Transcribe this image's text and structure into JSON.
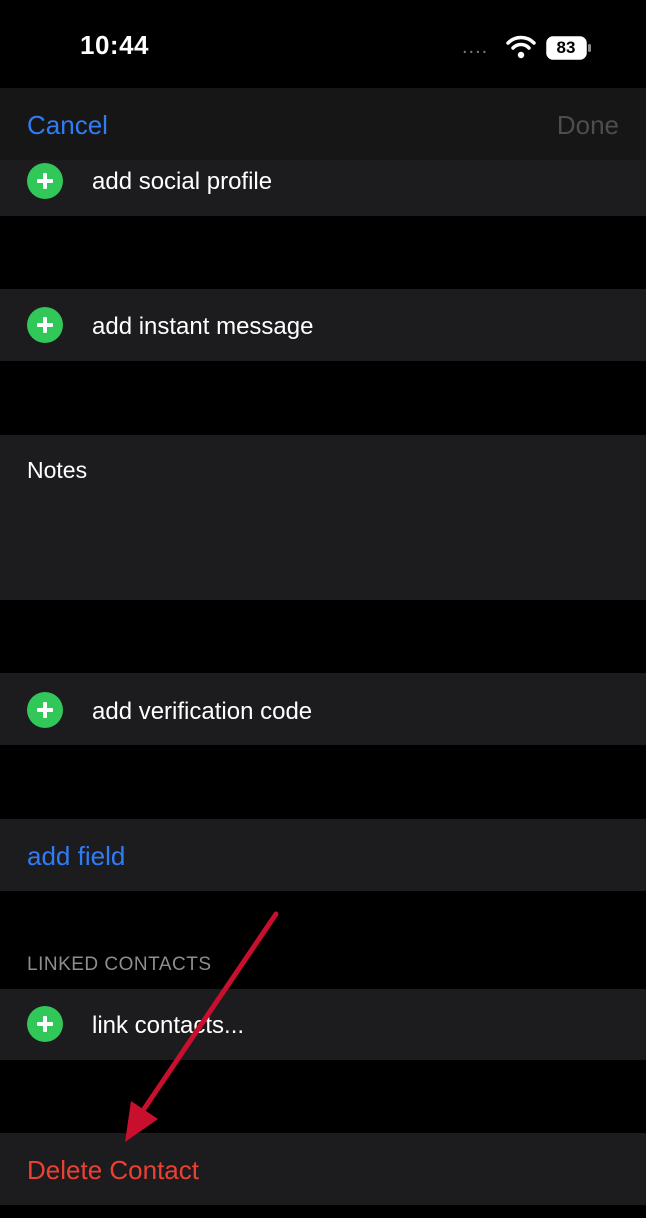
{
  "status_bar": {
    "time": "10:44",
    "signal": "....",
    "battery_level": "83"
  },
  "nav": {
    "cancel_label": "Cancel",
    "done_label": "Done"
  },
  "rows": {
    "social_profile": "add social profile",
    "instant_message": "add instant message",
    "notes_label": "Notes",
    "verification_code": "add verification code",
    "add_field": "add field",
    "linked_contacts_header": "LINKED CONTACTS",
    "link_contacts": "link contacts...",
    "delete_contact": "Delete Contact"
  },
  "colors": {
    "accent_blue": "#2f7cf6",
    "add_green": "#32c759",
    "destructive_red": "#eb4034",
    "annotation_arrow": "#c8102e"
  }
}
